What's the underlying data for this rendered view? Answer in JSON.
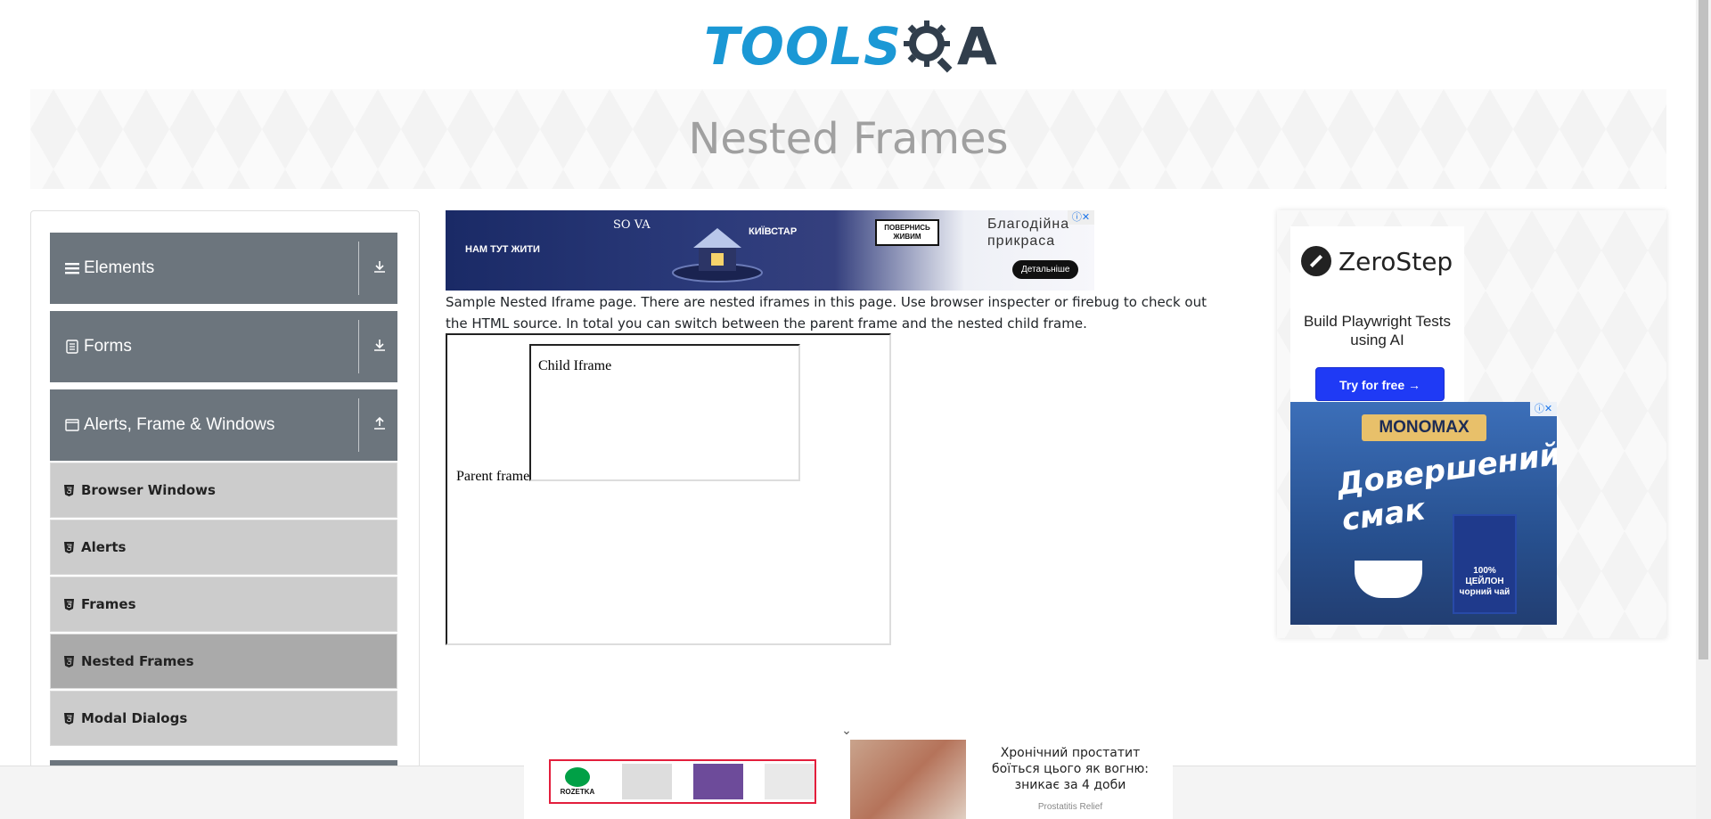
{
  "header": {
    "logo_tools": "TOOLS",
    "logo_qa": "A"
  },
  "banner": {
    "title": "Nested Frames"
  },
  "sidebar": {
    "groups": [
      {
        "label": "Elements",
        "icon": "hamburger-icon",
        "toggle": "download-icon"
      },
      {
        "label": "Forms",
        "icon": "document-icon",
        "toggle": "download-icon"
      },
      {
        "label": "Alerts, Frame & Windows",
        "icon": "window-icon",
        "toggle": "upload-icon"
      }
    ],
    "items": [
      {
        "label": "Browser Windows",
        "active": false
      },
      {
        "label": "Alerts",
        "active": false
      },
      {
        "label": "Frames",
        "active": false
      },
      {
        "label": "Nested Frames",
        "active": true
      },
      {
        "label": "Modal Dialogs",
        "active": false
      }
    ]
  },
  "main": {
    "description": "Sample Nested Iframe page. There are nested iframes in this page. Use browser inspecter or firebug to check out the HTML source. In total you can switch between the parent frame and the nested child frame.",
    "parent_frame_label": "Parent frame",
    "child_frame_label": "Child Iframe"
  },
  "ad_top": {
    "left_text": "НАМ ТУТ ЖИТИ",
    "sova": "SO VA",
    "kyivstar": "КИЇВСТАР",
    "badge": "ПОВЕРНИСЬ ЖИВИМ",
    "headline": "Благодійна прикраса",
    "cta": "Детальніше"
  },
  "ad_right": {
    "zerostep_name": "ZeroStep",
    "zerostep_tagline": "Build Playwright Tests using AI",
    "zerostep_cta": "Try for free →",
    "monomax_brand": "MONOMAX",
    "monomax_headline": "Довершений смак",
    "monomax_box": "100% ЦЕЙЛОН чорний чай"
  },
  "ad_bottom": {
    "rozetka_name": "ROZETKA",
    "article_text": "Хронічний простатит боїться цього як вогню: зникає за 4 доби",
    "article_source": "Prostatitis Relief"
  },
  "colors": {
    "brand_blue": "#1b98d5",
    "brand_dark": "#313e4c",
    "group_bg": "#6c757d",
    "item_bg": "#cccccc",
    "item_active_bg": "#aaaaaa",
    "zerostep_button": "#1f3af5"
  }
}
